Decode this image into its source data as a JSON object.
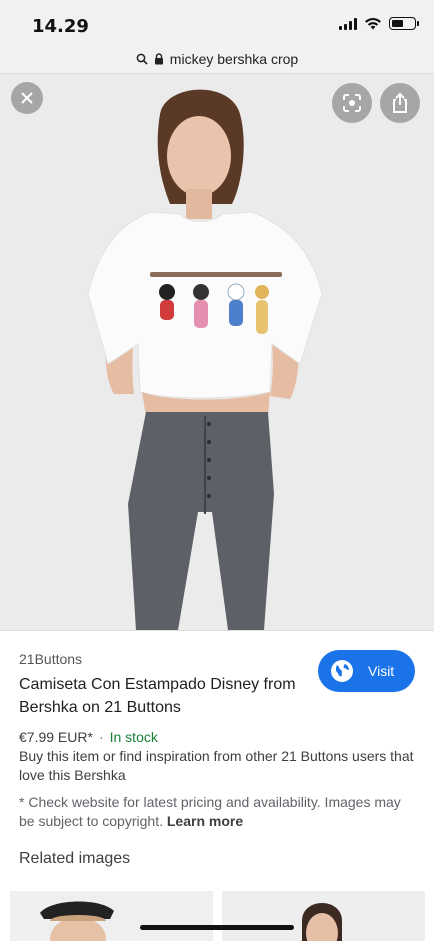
{
  "status_bar": {
    "time": "14.29"
  },
  "address_bar": {
    "url_text": "mickey bershka crop",
    "icons": [
      "search-icon",
      "lock-icon"
    ]
  },
  "image_viewer": {
    "buttons": [
      "close-icon",
      "lens-icon",
      "share-icon"
    ]
  },
  "result": {
    "source": "21Buttons",
    "title": "Camiseta Con Estampado Disney from Bershka on 21 Buttons",
    "visit_label": "Visit",
    "price": "€7.99 EUR*",
    "separator": "·",
    "stock": "In stock",
    "description": "Buy this item or find inspiration from other 21 Buttons users that love this Bershka",
    "disclaimer": "* Check website for latest pricing and availability. Images may be subject to copyright.",
    "learn_more": "Learn more",
    "related_heading": "Related images",
    "visit_color": "#1a73e8",
    "stock_color": "#188038"
  }
}
